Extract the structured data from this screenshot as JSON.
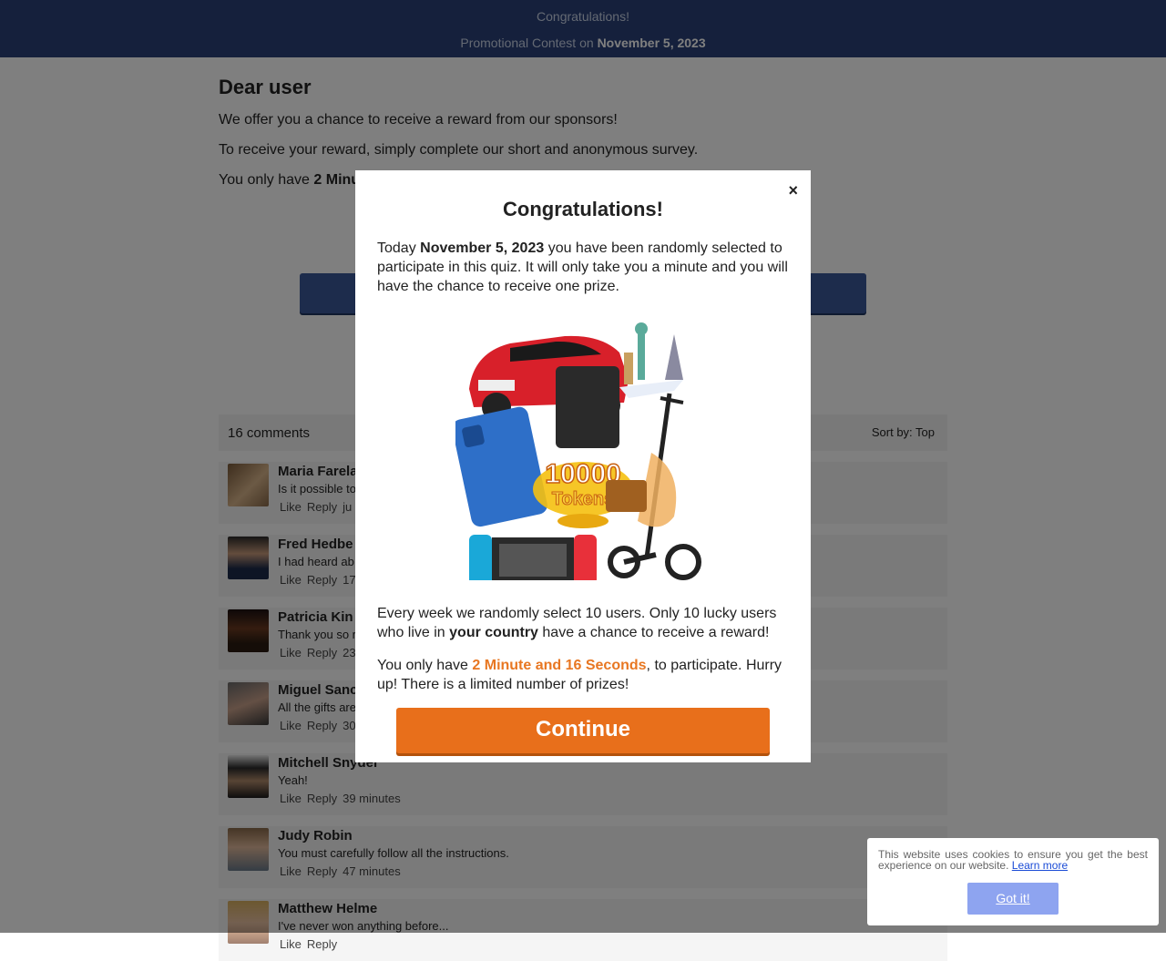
{
  "header": {
    "line1": "Congratulations!",
    "line2_prefix": "Promotional Contest on",
    "line2_date": "November 5, 2023"
  },
  "main": {
    "heading": "Dear user",
    "p1": "We offer you a chance to receive a reward from our sponsors!",
    "p2": "To receive your reward, simply complete our short and anonymous survey.",
    "p3_prefix": "You only have",
    "p3_bold": "2 Minu"
  },
  "comments": {
    "count_label": "16 comments",
    "sort_label": "Sort by: Top",
    "items": [
      {
        "name": "Maria Farela",
        "text": "Is it possible to",
        "like": "Like",
        "reply": "Reply",
        "time": "ju"
      },
      {
        "name": "Fred Hedbe",
        "text": "I had heard ab",
        "like": "Like",
        "reply": "Reply",
        "time": "17"
      },
      {
        "name": "Patricia Kin",
        "text": "Thank you so r",
        "like": "Like",
        "reply": "Reply",
        "time": "23"
      },
      {
        "name": "Miguel Sanc",
        "text": "All the gifts are",
        "like": "Like",
        "reply": "Reply",
        "time": "30"
      },
      {
        "name": "Mitchell Snyder",
        "text": "Yeah!",
        "like": "Like",
        "reply": "Reply",
        "time": "39 minutes"
      },
      {
        "name": "Judy Robin",
        "text": "You must carefully follow all the instructions.",
        "like": "Like",
        "reply": "Reply",
        "time": "47 minutes"
      },
      {
        "name": "Matthew Helme",
        "text": "I've never won anything before...",
        "like": "Like",
        "reply": "Reply",
        "time": ""
      }
    ]
  },
  "modal": {
    "close_glyph": "×",
    "title": "Congratulations!",
    "para1_prefix": "Today",
    "para1_date": "November 5, 2023",
    "para1_rest": "you have been randomly selected to participate in this quiz. It will only take you a minute and you will have the chance to receive one prize.",
    "para2_prefix": "Every week we randomly select 10 users. Only 10 lucky users who live in",
    "para2_bold": "your country",
    "para2_rest": "have a chance to receive a reward!",
    "para3_prefix": "You only have",
    "para3_timer": "2 Minute and 16 Seconds",
    "para3_rest": ", to participate. Hurry up! There is a limited number of prizes!",
    "tokens_label": "10000 Tokens",
    "continue_label": "Continue",
    "accent_color": "#e86f1b"
  },
  "cookie": {
    "text": "This website uses cookies to ensure you get the best experience on our website.",
    "link": "Learn more",
    "button": "Got it!"
  }
}
